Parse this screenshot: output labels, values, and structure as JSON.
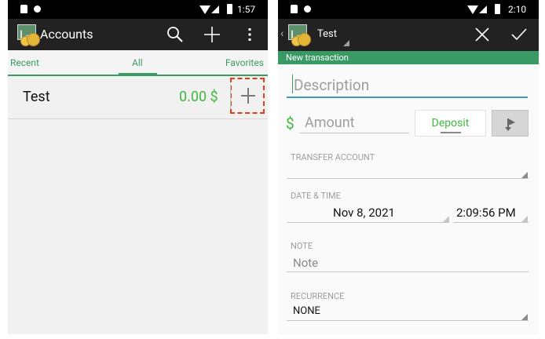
{
  "left": {
    "status": {
      "time": "1:57"
    },
    "actionbar": {
      "title": "Accounts",
      "search_icon": "search-icon",
      "add_icon": "plus-icon",
      "menu_icon": "overflow-menu-icon"
    },
    "tabs": {
      "recent": "Recent",
      "all": "All",
      "favorites": "Favorites",
      "selected": "All"
    },
    "accounts": [
      {
        "name": "Test",
        "balance": "0.00 $"
      }
    ],
    "colors": {
      "accent": "#3a9a64",
      "balance": "#3db83d",
      "highlight": "#e53b16"
    }
  },
  "right": {
    "status": {
      "time": "2:10"
    },
    "actionbar": {
      "account": "Test",
      "close_icon": "close-icon",
      "check_icon": "checkmark-icon"
    },
    "banner": "New transaction",
    "description": {
      "placeholder": "Description"
    },
    "amount": {
      "currency": "$",
      "placeholder": "Amount",
      "type_button": "Deposit"
    },
    "transfer": {
      "label": "TRANSFER ACCOUNT"
    },
    "datetime": {
      "label": "DATE & TIME",
      "date": "Nov 8, 2021",
      "time": "2:09:56 PM"
    },
    "note": {
      "label": "NOTE",
      "placeholder": "Note"
    },
    "recurrence": {
      "label": "RECURRENCE",
      "value": "NONE"
    }
  }
}
